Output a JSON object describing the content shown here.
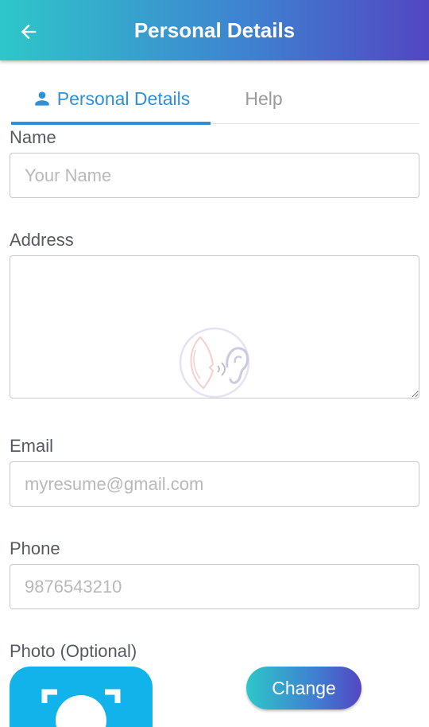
{
  "appbar": {
    "title": "Personal Details",
    "back_icon": "arrow-left-icon",
    "gradient": [
      "#2ec7c9",
      "#3f7fd0",
      "#5346c2"
    ]
  },
  "tabs": [
    {
      "label": "Personal Details",
      "icon": "person-icon",
      "active": true
    },
    {
      "label": "Help",
      "active": false
    }
  ],
  "form": {
    "name": {
      "label": "Name",
      "value": "",
      "placeholder": "Your Name"
    },
    "address": {
      "label": "Address",
      "value": "",
      "placeholder": ""
    },
    "email": {
      "label": "Email",
      "value": "",
      "placeholder": "myresume@gmail.com"
    },
    "phone": {
      "label": "Phone",
      "value": "",
      "placeholder": "9876543210"
    },
    "photo": {
      "label": "Photo (Optional)",
      "change_label": "Change"
    }
  },
  "colors": {
    "accent": "#2f8fd8",
    "photo_bg": "#12b3ea",
    "inactive_tab": "#9a9a9a"
  }
}
